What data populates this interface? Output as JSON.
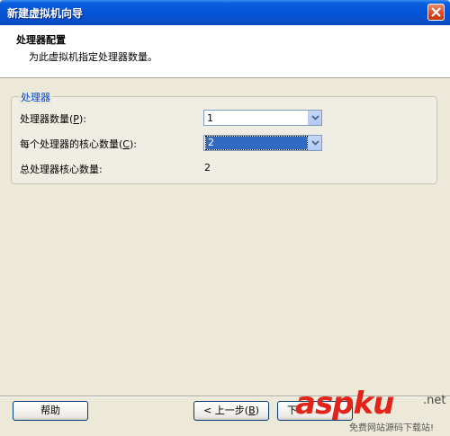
{
  "window": {
    "title": "新建虚拟机向导"
  },
  "header": {
    "title": "处理器配置",
    "subtitle": "为此虚拟机指定处理器数量。"
  },
  "group": {
    "legend": "处理器",
    "processor_count": {
      "label": "处理器数量(",
      "mnemonic": "P",
      "label_end": "):",
      "value": "1"
    },
    "cores_per_processor": {
      "label": "每个处理器的核心数量(",
      "mnemonic": "C",
      "label_end": "):",
      "value": "2"
    },
    "total_cores": {
      "label": "总处理器核心数量:",
      "value": "2"
    }
  },
  "buttons": {
    "help": "帮助",
    "back": "< 上一步(",
    "back_mnemonic": "B",
    "back_end": ")",
    "next": "下"
  },
  "watermark": {
    "brand": "aspku",
    "tld": ".net",
    "tagline": "免费网站源码下载站!"
  },
  "colors": {
    "titlebar": "#0553d4",
    "accent": "#0046d5",
    "selection": "#316ac5",
    "watermark": "#e2231a"
  }
}
